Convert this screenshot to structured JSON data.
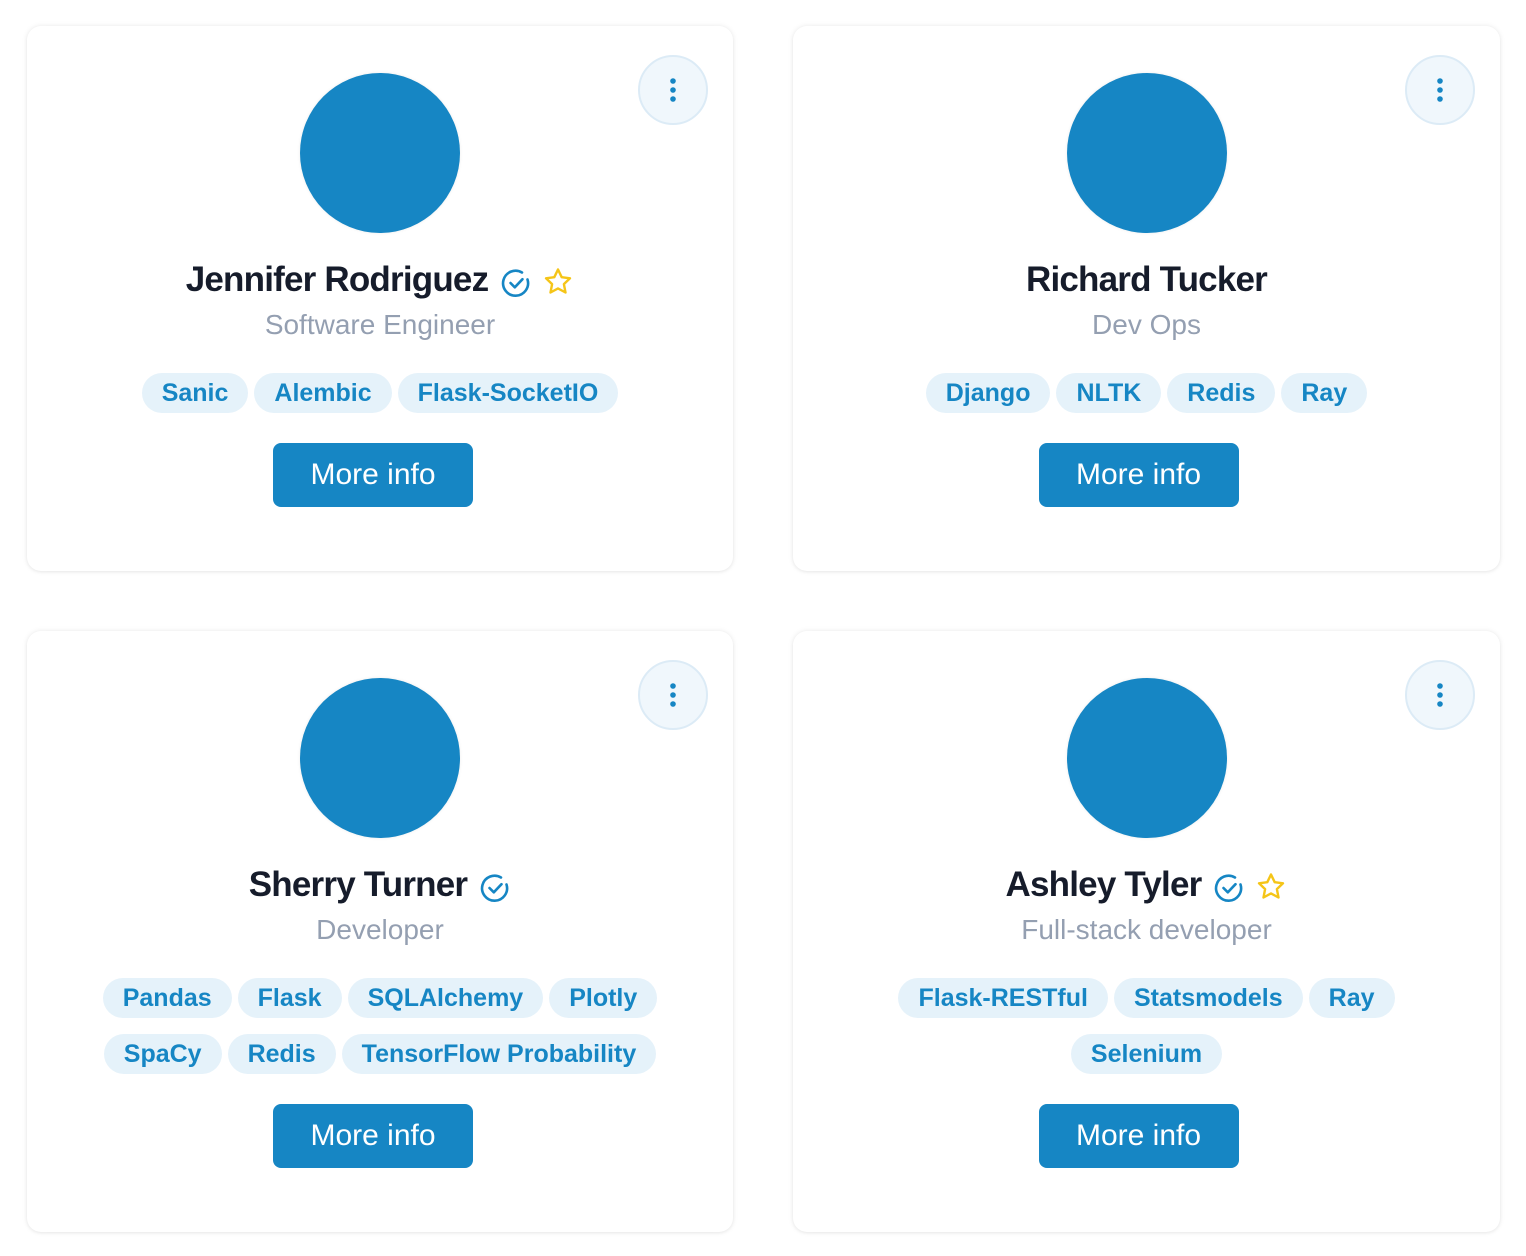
{
  "cards": [
    {
      "name": "Jennifer Rodriguez",
      "role": "Software Engineer",
      "verified": true,
      "starred": true,
      "tags": [
        "Sanic",
        "Alembic",
        "Flask-SocketIO"
      ],
      "button_label": "More info",
      "menu_icon": "more-vertical-icon"
    },
    {
      "name": "Richard Tucker",
      "role": "Dev Ops",
      "verified": false,
      "starred": false,
      "tags": [
        "Django",
        "NLTK",
        "Redis",
        "Ray"
      ],
      "button_label": "More info",
      "menu_icon": "more-vertical-icon"
    },
    {
      "name": "Sherry Turner",
      "role": "Developer",
      "verified": true,
      "starred": false,
      "tags": [
        "Pandas",
        "Flask",
        "SQLAlchemy",
        "Plotly",
        "SpaCy",
        "Redis",
        "TensorFlow Probability"
      ],
      "button_label": "More info",
      "menu_icon": "more-vertical-icon"
    },
    {
      "name": "Ashley Tyler",
      "role": "Full-stack developer",
      "verified": true,
      "starred": true,
      "tags": [
        "Flask-RESTful",
        "Statsmodels",
        "Ray",
        "Selenium"
      ],
      "button_label": "More info",
      "menu_icon": "more-vertical-icon"
    }
  ],
  "colors": {
    "accent": "#1686c4",
    "tag_bg": "#e5f2fa",
    "name_text": "#161c2b",
    "role_text": "#949fb1",
    "star": "#f5c518"
  }
}
